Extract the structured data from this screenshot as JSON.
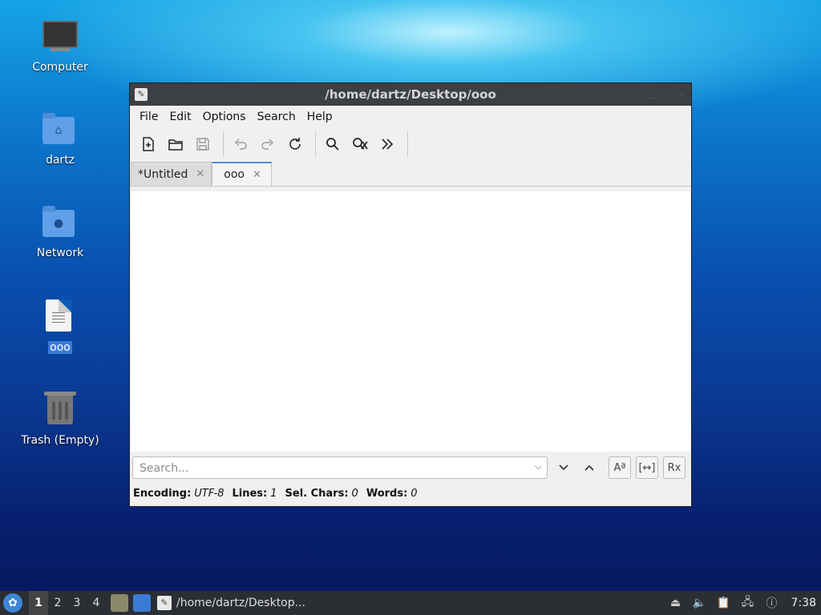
{
  "desktop": {
    "icons": [
      {
        "label": "Computer"
      },
      {
        "label": "dartz"
      },
      {
        "label": "Network"
      },
      {
        "label": "ooo"
      },
      {
        "label": "Trash (Empty)"
      }
    ]
  },
  "window": {
    "title": "/home/dartz/Desktop/ooo",
    "menu": [
      "File",
      "Edit",
      "Options",
      "Search",
      "Help"
    ],
    "toolbar_icons": [
      "new-file-icon",
      "open-folder-icon",
      "save-icon",
      "undo-icon",
      "redo-icon",
      "reload-icon",
      "find-icon",
      "replace-icon",
      "go-to-icon"
    ],
    "tabs": [
      {
        "label": "*Untitled",
        "active": false
      },
      {
        "label": "ooo",
        "active": true
      }
    ],
    "search": {
      "placeholder": "Search..."
    },
    "status": {
      "encoding_label": "Encoding:",
      "encoding_value": "UTF-8",
      "lines_label": "Lines:",
      "lines_value": "1",
      "sel_label": "Sel. Chars:",
      "sel_value": "0",
      "words_label": "Words:",
      "words_value": "0"
    }
  },
  "taskbar": {
    "workspaces": [
      "1",
      "2",
      "3",
      "4"
    ],
    "active_workspace": "1",
    "task_label": "/home/dartz/Desktop...",
    "clock": "7:38"
  }
}
